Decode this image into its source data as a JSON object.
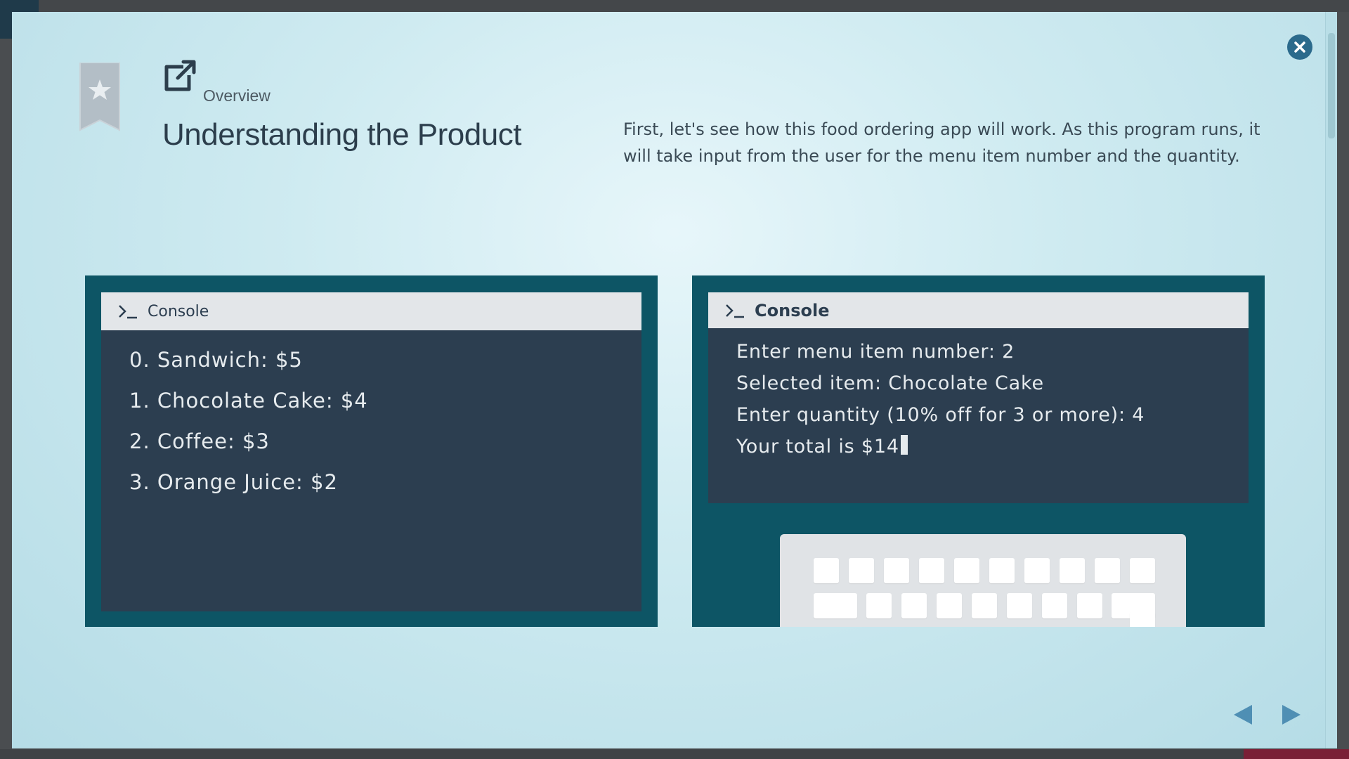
{
  "header": {
    "section": "Overview",
    "title": "Understanding the Product",
    "intro": "First, let's see how this food ordering app will work. As this program runs, it will take input from the user for the menu item number and the quantity."
  },
  "left_console": {
    "title": "Console",
    "lines": [
      "0. Sandwich: $5",
      "1. Chocolate Cake: $4",
      "2. Coffee: $3",
      "3. Orange Juice: $2"
    ]
  },
  "right_console": {
    "title": "Console",
    "lines": [
      "Enter menu item number: 2",
      "Selected item: Chocolate Cake",
      "Enter quantity (10% off for 3 or more): 4",
      "Your total is $14"
    ]
  },
  "icons": {
    "bookmark": "bookmark-star-icon",
    "external": "external-link-icon",
    "close": "close-icon",
    "prompt": "terminal-prompt-icon",
    "prev": "previous-arrow-icon",
    "next": "next-arrow-icon"
  },
  "colors": {
    "panel": "#0d5565",
    "console": "#2c3e50",
    "accent": "#2b6a8c"
  }
}
